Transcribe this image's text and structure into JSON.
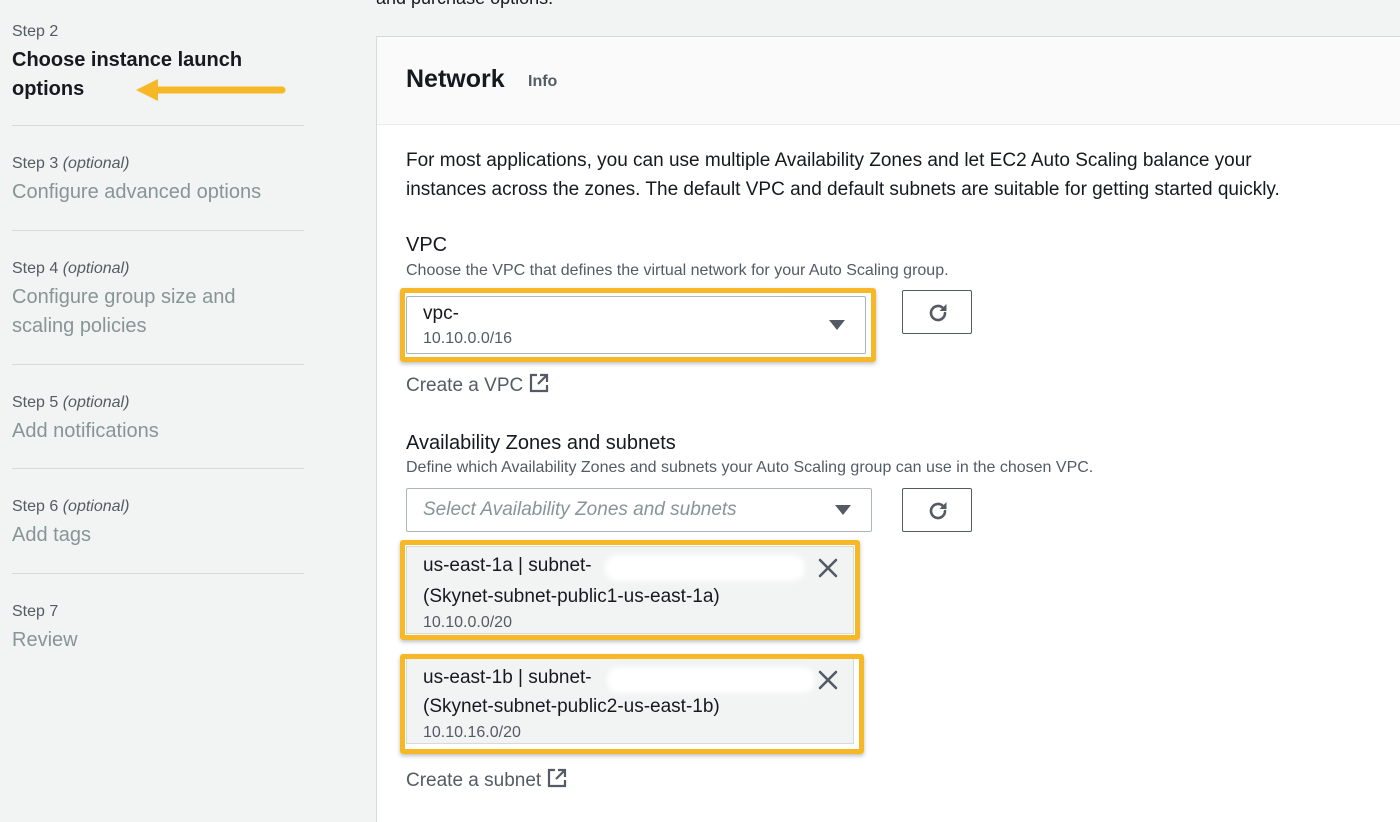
{
  "steps": [
    {
      "num": "Step 2",
      "optional": "",
      "title_line1": "Choose instance launch",
      "title_line2": "options"
    },
    {
      "num": "Step 3",
      "optional": "(optional)",
      "title_line1": "Configure advanced options",
      "title_line2": ""
    },
    {
      "num": "Step 4",
      "optional": "(optional)",
      "title_line1": "Configure group size and",
      "title_line2": "scaling policies"
    },
    {
      "num": "Step 5",
      "optional": "(optional)",
      "title_line1": "Add notifications",
      "title_line2": ""
    },
    {
      "num": "Step 6",
      "optional": "(optional)",
      "title_line1": "Add tags",
      "title_line2": ""
    },
    {
      "num": "Step 7",
      "optional": "",
      "title_line1": "Review",
      "title_line2": ""
    }
  ],
  "top_text": "and purchase options.",
  "network": {
    "title": "Network",
    "info": "Info",
    "intro_line1": "For most applications, you can use multiple Availability Zones and let EC2 Auto Scaling balance your",
    "intro_line2": "instances across the zones. The default VPC and default subnets are suitable for getting started quickly."
  },
  "vpc": {
    "label": "VPC",
    "description": "Choose the VPC that defines the virtual network for your Auto Scaling group.",
    "selected_prefix": "vpc-",
    "selected_cidr": "10.10.0.0/16",
    "create_link": "Create a VPC"
  },
  "subnets": {
    "label": "Availability Zones and subnets",
    "description": "Define which Availability Zones and subnets your Auto Scaling group can use in the chosen VPC.",
    "placeholder": "Select Availability Zones and subnets",
    "tokens": [
      {
        "zone": "us-east-1a | subnet-",
        "name": "(Skynet-subnet-public1-us-east-1a)",
        "cidr": "10.10.0.0/20"
      },
      {
        "zone": "us-east-1b | subnet-",
        "name": "(Skynet-subnet-public2-us-east-1b)",
        "cidr": "10.10.16.0/20"
      }
    ],
    "create_link": "Create a subnet"
  },
  "colors": {
    "highlight": "#f6b826",
    "annotation_arrow": "#f6b826",
    "text_primary": "#16191f",
    "text_secondary": "#545b64"
  },
  "icons": [
    "refresh-icon",
    "external-link-icon",
    "close-icon",
    "caret-down-icon",
    "arrow-annotation"
  ]
}
